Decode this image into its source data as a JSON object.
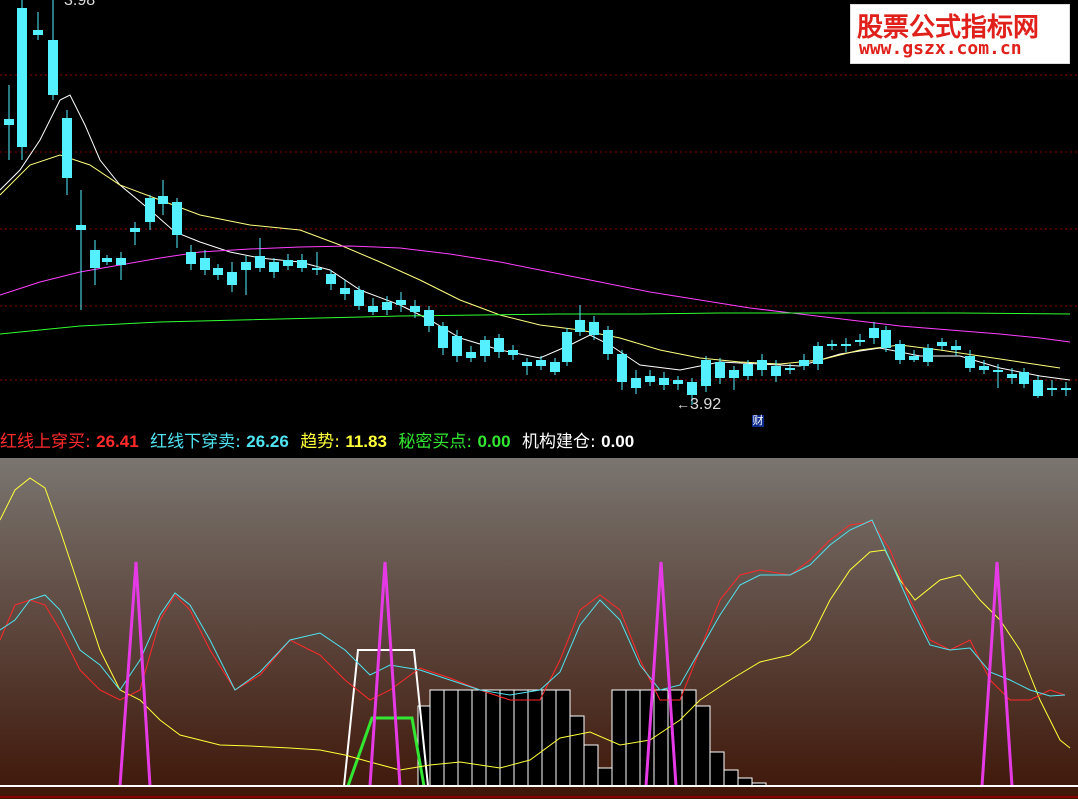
{
  "upper_price_label": "3.98",
  "low_price_label": "3.92",
  "low_price_arrow": "←",
  "fin_badge": "财",
  "watermark": {
    "title": "股票公式指标网",
    "url": "www.gszx.com.cn"
  },
  "legend": [
    {
      "label": "红线上穿买",
      "value": "26.41",
      "color": "#ff2a2a"
    },
    {
      "label": "红线下穿卖",
      "value": "26.26",
      "color": "#4fe3f0"
    },
    {
      "label": "趋势",
      "value": "11.83",
      "color": "#ffff3a"
    },
    {
      "label": "秘密买点",
      "value": "0.00",
      "color": "#32e632"
    },
    {
      "label": "机构建仓",
      "value": "0.00",
      "color": "#ffffff"
    }
  ],
  "colors": {
    "up_candle": "#ff3232",
    "down_candle": "#54f0ff",
    "ma_short": "#ffffff",
    "ma_mid": "#ffff80",
    "ma_long": "#ff40ff",
    "ma_vlong": "#30ff30",
    "grid": "#8b0000",
    "sub_bg_top": "#7a7570",
    "sub_bg_bottom": "#3e1608"
  }
}
